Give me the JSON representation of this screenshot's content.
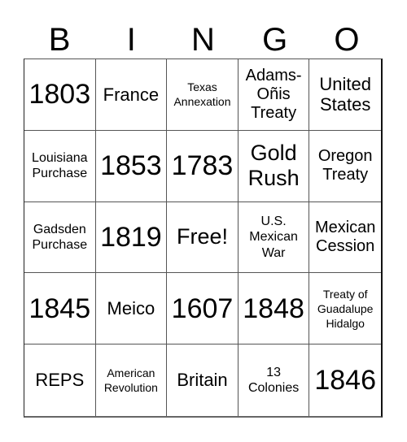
{
  "header": [
    "B",
    "I",
    "N",
    "G",
    "O"
  ],
  "cells": [
    {
      "text": "1803",
      "size": "s-xl"
    },
    {
      "text": "France",
      "size": "s-m"
    },
    {
      "text": "Texas Annexation",
      "size": "s-xs"
    },
    {
      "text": "Adams-Oñis Treaty",
      "size": "s-ms"
    },
    {
      "text": "United States",
      "size": "s-m"
    },
    {
      "text": "Louisiana Purchase",
      "size": "s-s"
    },
    {
      "text": "1853",
      "size": "s-xl"
    },
    {
      "text": "1783",
      "size": "s-xl"
    },
    {
      "text": "Gold Rush",
      "size": "s-l"
    },
    {
      "text": "Oregon Treaty",
      "size": "s-ms"
    },
    {
      "text": "Gadsden Purchase",
      "size": "s-s"
    },
    {
      "text": "1819",
      "size": "s-xl"
    },
    {
      "text": "Free!",
      "size": "s-l"
    },
    {
      "text": "U.S. Mexican War",
      "size": "s-s"
    },
    {
      "text": "Mexican Cession",
      "size": "s-ms"
    },
    {
      "text": "1845",
      "size": "s-xl"
    },
    {
      "text": "Meico",
      "size": "s-m"
    },
    {
      "text": "1607",
      "size": "s-xl"
    },
    {
      "text": "1848",
      "size": "s-xl"
    },
    {
      "text": "Treaty of Guadalupe Hidalgo",
      "size": "s-xs"
    },
    {
      "text": "REPS",
      "size": "s-m"
    },
    {
      "text": "American Revolution",
      "size": "s-xs"
    },
    {
      "text": "Britain",
      "size": "s-m"
    },
    {
      "text": "13 Colonies",
      "size": "s-s"
    },
    {
      "text": "1846",
      "size": "s-xl"
    }
  ]
}
